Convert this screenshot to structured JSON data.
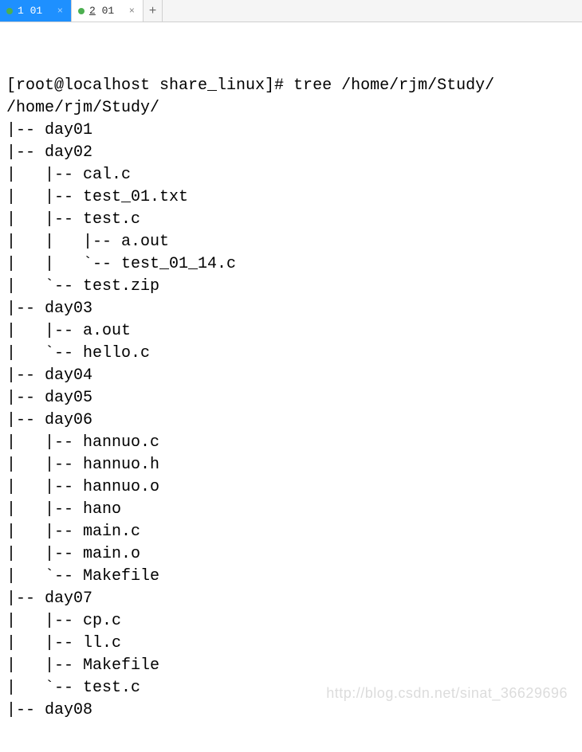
{
  "tabs": {
    "items": [
      {
        "label": "1 01",
        "active": true
      },
      {
        "label": "2 01",
        "active": false
      }
    ],
    "add_label": "+"
  },
  "terminal": {
    "prompt": "[root@localhost share_linux]# tree /home/rjm/Study/",
    "lines": [
      "/home/rjm/Study/",
      "|-- day01",
      "|-- day02",
      "|   |-- cal.c",
      "|   |-- test_01.txt",
      "|   |-- test.c",
      "|   |   |-- a.out",
      "|   |   `-- test_01_14.c",
      "|   `-- test.zip",
      "|-- day03",
      "|   |-- a.out",
      "|   `-- hello.c",
      "|-- day04",
      "|-- day05",
      "|-- day06",
      "|   |-- hannuo.c",
      "|   |-- hannuo.h",
      "|   |-- hannuo.o",
      "|   |-- hano",
      "|   |-- main.c",
      "|   |-- main.o",
      "|   `-- Makefile",
      "|-- day07",
      "|   |-- cp.c",
      "|   |-- ll.c",
      "|   |-- Makefile",
      "|   `-- test.c",
      "|-- day08"
    ]
  },
  "watermark": "http://blog.csdn.net/sinat_36629696"
}
